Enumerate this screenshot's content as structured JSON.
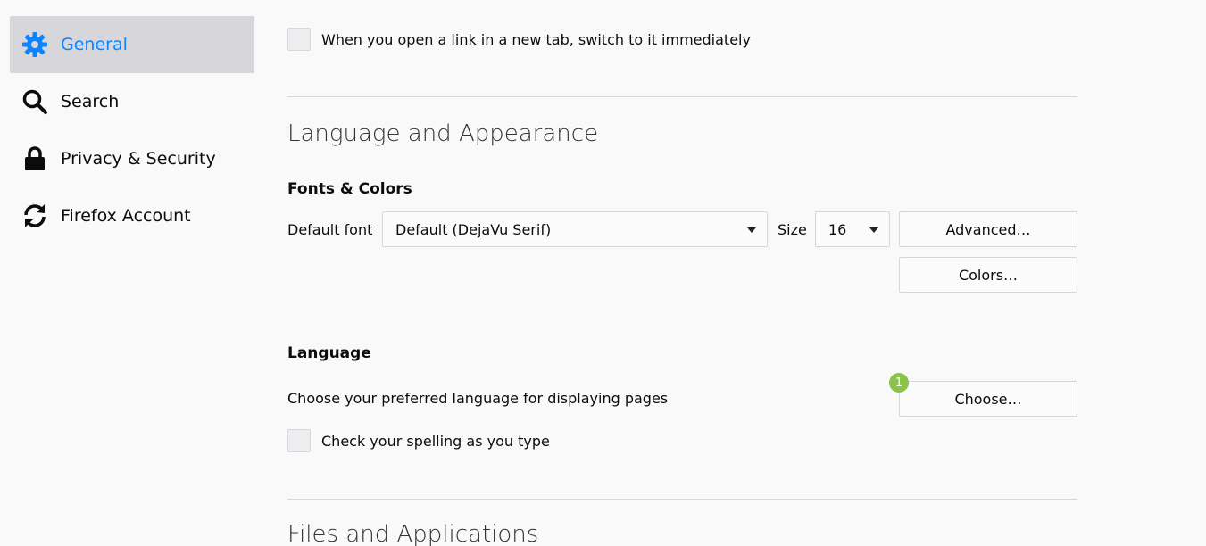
{
  "sidebar": {
    "items": [
      {
        "label": "General",
        "icon": "gear-icon",
        "selected": true
      },
      {
        "label": "Search",
        "icon": "search-icon"
      },
      {
        "label": "Privacy & Security",
        "icon": "lock-icon"
      },
      {
        "label": "Firefox Account",
        "icon": "sync-icon"
      }
    ]
  },
  "tabs": {
    "switch_new_tab_label": "When you open a link in a new tab, switch to it immediately"
  },
  "language_appearance": {
    "title": "Language and Appearance",
    "fonts_colors": {
      "title": "Fonts & Colors",
      "default_font_label": "Default font",
      "default_font_value": "Default (DejaVu Serif)",
      "size_label": "Size",
      "size_value": "16",
      "advanced_button": "Advanced…",
      "colors_button": "Colors…"
    },
    "language": {
      "title": "Language",
      "choose_label": "Choose your preferred language for displaying pages",
      "choose_button": "Choose…",
      "badge": "1",
      "spelling_label": "Check your spelling as you type"
    }
  },
  "files_applications": {
    "title": "Files and Applications"
  },
  "colors": {
    "accent": "#0a84ff",
    "badge": "#8bc34a"
  }
}
